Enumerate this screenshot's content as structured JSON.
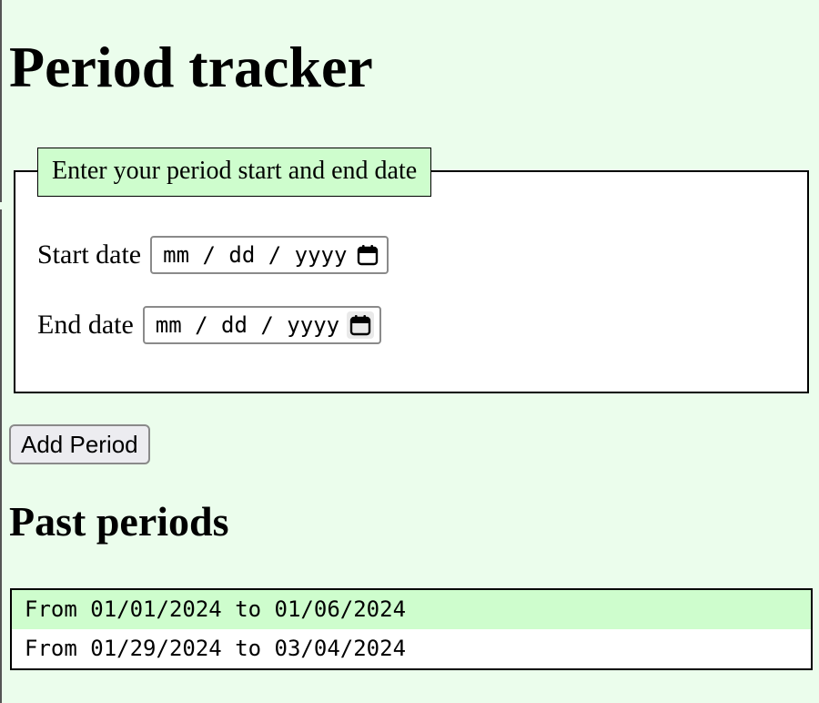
{
  "page": {
    "title": "Period tracker",
    "background_color": "#ebfdec",
    "accent_color": "#cefdcd"
  },
  "form": {
    "legend": "Enter your period start and end date",
    "start_date": {
      "label": "Start date",
      "value": "",
      "placeholder": "mm / dd / yyyy",
      "icon": "calendar-icon"
    },
    "end_date": {
      "label": "End date",
      "value": "",
      "placeholder": "mm / dd / yyyy",
      "icon": "calendar-icon"
    },
    "submit_label": "Add Period"
  },
  "past": {
    "heading": "Past periods",
    "items": [
      "From 01/01/2024 to 01/06/2024",
      "From 01/29/2024 to 03/04/2024"
    ]
  }
}
